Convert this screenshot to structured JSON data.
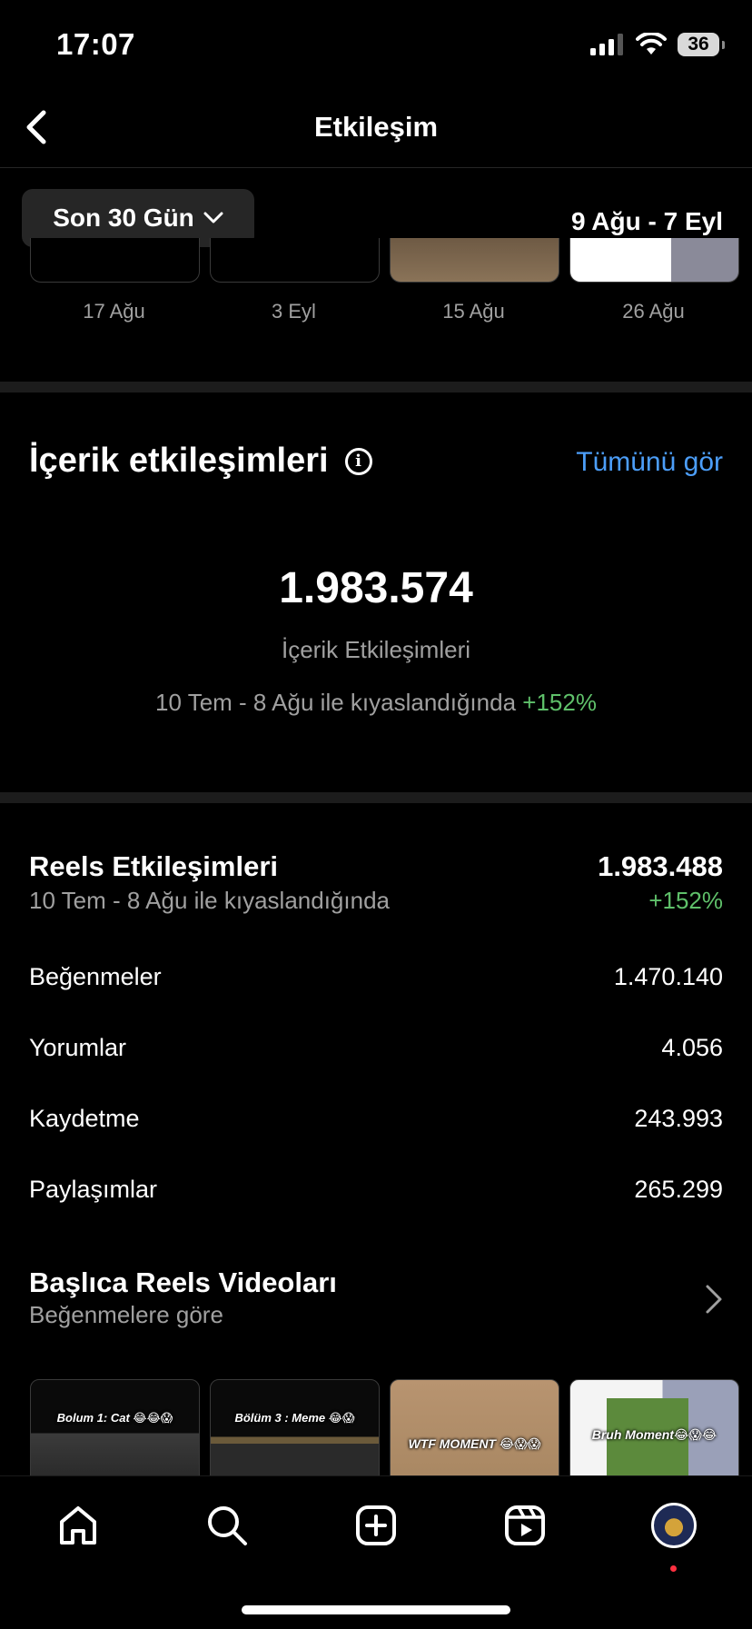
{
  "status_bar": {
    "time": "17:07",
    "battery": "36"
  },
  "nav": {
    "title": "Etkileşim"
  },
  "filter": {
    "range_label": "Son 30 Gün",
    "date_range": "9 Ağu - 7 Eyl"
  },
  "top_posts": {
    "dates": [
      "17 Ağu",
      "3 Eyl",
      "15 Ağu",
      "26 Ağu"
    ]
  },
  "content_interactions": {
    "title": "İçerik etkileşimleri",
    "see_all": "Tümünü gör",
    "total": "1.983.574",
    "label": "İçerik Etkileşimleri",
    "compare_text": "10 Tem - 8 Ağu ile kıyaslandığında",
    "compare_pct": "+152%"
  },
  "reels": {
    "title": "Reels Etkileşimleri",
    "compare_text": "10 Tem - 8 Ağu ile kıyaslandığında",
    "total": "1.983.488",
    "pct": "+152%",
    "rows": [
      {
        "label": "Beğenmeler",
        "value": "1.470.140"
      },
      {
        "label": "Yorumlar",
        "value": "4.056"
      },
      {
        "label": "Kaydetme",
        "value": "243.993"
      },
      {
        "label": "Paylaşımlar",
        "value": "265.299"
      }
    ]
  },
  "top_reels": {
    "title": "Başlıca Reels Videoları",
    "subtitle": "Beğenmelere göre",
    "thumbs": [
      {
        "caption": "Bolum 1: Cat 😂😂😱"
      },
      {
        "caption": "Bölüm 3 : Meme 😂😱"
      },
      {
        "caption": "WTF MOMENT 😂😱😱"
      },
      {
        "caption": "Bruh Moment😂😱😂"
      }
    ]
  },
  "tabbar": {
    "items": [
      "home-icon",
      "search-icon",
      "create-icon",
      "reels-icon",
      "profile-avatar"
    ]
  },
  "colors": {
    "accent": "#4c9ef9",
    "positive": "#5fc06a",
    "background": "#000000"
  }
}
